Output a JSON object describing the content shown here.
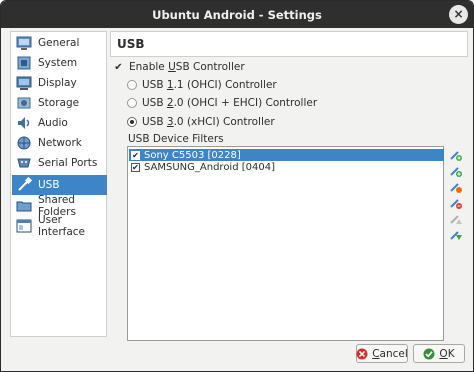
{
  "window": {
    "title": "Ubuntu Android - Settings",
    "close_glyph": "×"
  },
  "sidebar": {
    "items": [
      {
        "label": "General",
        "icon": "general-icon"
      },
      {
        "label": "System",
        "icon": "system-icon"
      },
      {
        "label": "Display",
        "icon": "display-icon"
      },
      {
        "label": "Storage",
        "icon": "storage-icon"
      },
      {
        "label": "Audio",
        "icon": "audio-icon"
      },
      {
        "label": "Network",
        "icon": "network-icon"
      },
      {
        "label": "Serial Ports",
        "icon": "serial-ports-icon"
      },
      {
        "label": "USB",
        "icon": "usb-icon",
        "selected": true
      },
      {
        "label": "Shared Folders",
        "icon": "shared-folders-icon"
      },
      {
        "label": "User Interface",
        "icon": "user-interface-icon"
      }
    ]
  },
  "main": {
    "title": "USB",
    "enable_usb": {
      "pre": "Enable ",
      "key": "U",
      "post": "SB Controller",
      "checked": true
    },
    "controllers": [
      {
        "pre": "USB ",
        "key": "1",
        "post": ".1 (OHCI) Controller",
        "selected": false
      },
      {
        "pre": "USB ",
        "key": "2",
        "post": ".0 (OHCI + EHCI) Controller",
        "selected": false
      },
      {
        "pre": "USB ",
        "key": "3",
        "post": ".0 (xHCI) Controller",
        "selected": true
      }
    ],
    "filters_label": "USB Device Filters",
    "filters": [
      {
        "label": "Sony C5503 [0228]",
        "checked": true,
        "selected": true
      },
      {
        "label": "SAMSUNG_Android [0404]",
        "checked": true,
        "selected": false
      }
    ],
    "filter_tools": [
      "add-filter-icon",
      "add-from-device-icon",
      "edit-filter-icon",
      "remove-filter-icon",
      "move-up-icon",
      "move-down-icon"
    ]
  },
  "buttons": {
    "cancel": {
      "key": "C",
      "rest": "ancel"
    },
    "ok": {
      "key": "O",
      "rest": "K"
    }
  },
  "colors": {
    "selection": "#3d85c6",
    "titlebar": "#2f2f2f",
    "window": "#f2f2f1"
  }
}
